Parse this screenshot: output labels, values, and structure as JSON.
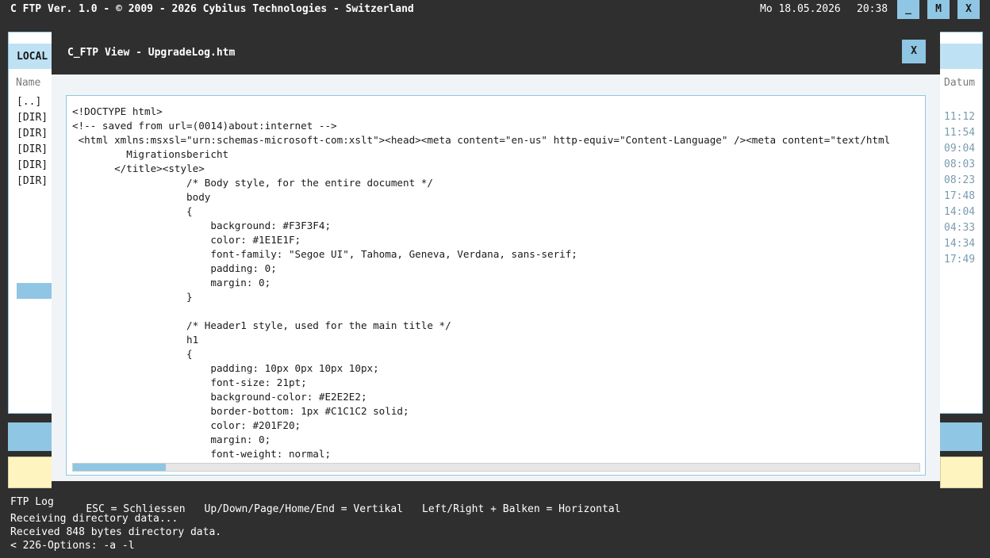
{
  "topbar": {
    "app_title": "C FTP Ver. 1.0 - © 2009 - 2026 Cybilus Technologies - Switzerland",
    "date": "Mo 18.05.2026",
    "time": "20:38",
    "btn_min": "_",
    "btn_max": "M",
    "btn_close": "X"
  },
  "left_panel": {
    "tab": "LOCAL",
    "col_name": "Name",
    "rows": [
      "[..]",
      "[DIR]",
      "[DIR]",
      "[DIR]",
      "[DIR]",
      "[DIR]"
    ]
  },
  "right_panel": {
    "col_date": "Datum",
    "times": [
      "11:12",
      "11:54",
      "09:04",
      "08:03",
      "08:23",
      "17:48",
      "14:04",
      "04:33",
      "14:34",
      "17:49"
    ]
  },
  "log": {
    "title": "FTP Log",
    "lines": "Receiving directory data...\nReceived 848 bytes directory data.\n< 226-Options: -a -l"
  },
  "modal": {
    "title": "C_FTP View - UpgradeLog.htm",
    "close": "X",
    "content": "<!DOCTYPE html>\n<!-- saved from url=(0014)about:internet -->\n <html xmlns:msxsl=\"urn:schemas-microsoft-com:xslt\"><head><meta content=\"en-us\" http-equiv=\"Content-Language\" /><meta content=\"text/html\n         Migrationsbericht\n       </title><style>\n                   /* Body style, for the entire document */\n                   body\n                   {\n                       background: #F3F3F4;\n                       color: #1E1E1F;\n                       font-family: \"Segoe UI\", Tahoma, Geneva, Verdana, sans-serif;\n                       padding: 0;\n                       margin: 0;\n                   }\n\n                   /* Header1 style, used for the main title */\n                   h1\n                   {\n                       padding: 10px 0px 10px 10px;\n                       font-size: 21pt;\n                       background-color: #E2E2E2;\n                       border-bottom: 1px #C1C1C2 solid;\n                       color: #201F20;\n                       margin: 0;\n                       font-weight: normal;",
    "footer": {
      "esc": "ESC = Schliessen",
      "vertical": "Up/Down/Page/Home/End = Vertikal",
      "horizontal": "Left/Right + Balken = Horizontal"
    }
  },
  "colors": {
    "accent": "#8fc6e3",
    "dark": "#2f2f2f",
    "yellow": "#fdf4c0"
  },
  "scroll": {
    "horizontal_fraction": 0.11
  }
}
